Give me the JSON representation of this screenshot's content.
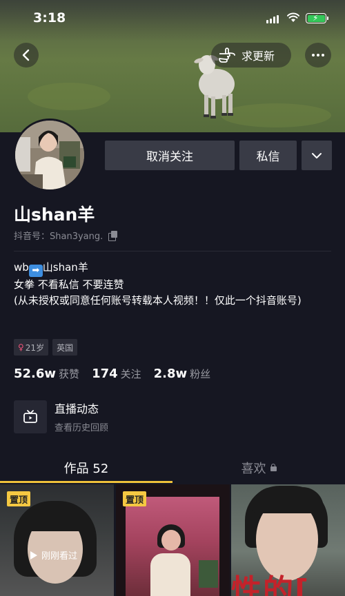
{
  "status_bar": {
    "time": "3:18"
  },
  "header": {
    "update_label": "求更新"
  },
  "profile": {
    "actions": {
      "unfollow": "取消关注",
      "message": "私信"
    },
    "name": "山shan羊",
    "douyin_id": "抖音号：Shan3yang.",
    "bio": {
      "line1_prefix": "wb",
      "line1_arrow": "➡",
      "line1_suffix": "山shan羊",
      "line2": "女拳 不看私信 不要连赞",
      "line3": "(从未授权或同意任何账号转载本人视频！！仅此一个抖音账号)"
    },
    "tags": {
      "age": "21岁",
      "age_symbol": "♀",
      "region": "英国"
    },
    "stats": [
      {
        "value": "52.6w",
        "label": "获赞"
      },
      {
        "value": "174",
        "label": "关注"
      },
      {
        "value": "2.8w",
        "label": "粉丝"
      }
    ],
    "live": {
      "title": "直播动态",
      "subtitle": "查看历史回顾"
    }
  },
  "tabs": [
    {
      "label": "作品 52"
    },
    {
      "label": "喜欢"
    }
  ],
  "videos": [
    {
      "pinned_label": "置顶",
      "overlay": "刚刚看过"
    },
    {
      "pinned_label": "置顶"
    },
    {
      "caption_text": "性的["
    }
  ],
  "colors": {
    "accent": "#f0c23a",
    "background": "#161722",
    "button": "#393b46"
  }
}
